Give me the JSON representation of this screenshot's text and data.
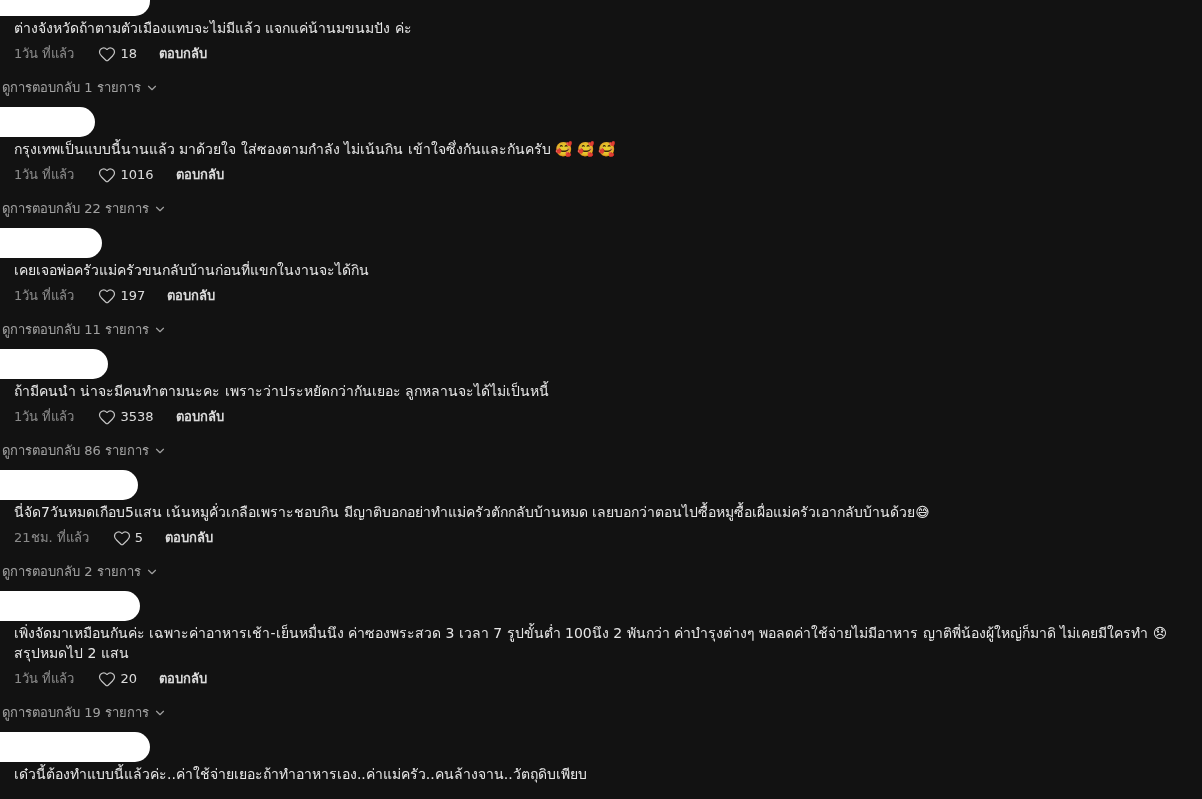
{
  "comments": [
    {
      "author_hidden": true,
      "text": "ต่างจังหวัดถ้าตามตัวเมืองแทบจะไม่มีแล้ว แจกแค่น้านมขนมปัง ค่ะ",
      "time": "1วัน ที่แล้ว",
      "likes": "18",
      "reply_label": "ตอบกลับ",
      "view_replies": "ดูการตอบกลับ 1 รายการ"
    },
    {
      "author_hidden": true,
      "text": "กรุงเทพเป็นแบบนี้นานแล้ว มาด้วยใจ ใส่ซองตามกำลัง ไม่เน้นกิน เข้าใจซึ่งกันและกันครับ 🥰 🥰 🥰",
      "time": "1วัน ที่แล้ว",
      "likes": "1016",
      "reply_label": "ตอบกลับ",
      "view_replies": "ดูการตอบกลับ 22 รายการ"
    },
    {
      "author_hidden": true,
      "text": "เคยเจอพ่อครัวแม่ครัวขนกลับบ้านก่อนที่แขกในงานจะได้กิน",
      "time": "1วัน ที่แล้ว",
      "likes": "197",
      "reply_label": "ตอบกลับ",
      "view_replies": "ดูการตอบกลับ 11 รายการ"
    },
    {
      "author_hidden": true,
      "text": "ถ้ามีคนนำ น่าจะมีคนทำตามนะคะ เพราะว่าประหยัดกว่ากันเยอะ ลูกหลานจะได้ไม่เป็นหนี้",
      "time": "1วัน ที่แล้ว",
      "likes": "3538",
      "reply_label": "ตอบกลับ",
      "view_replies": "ดูการตอบกลับ 86 รายการ"
    },
    {
      "author_hidden": true,
      "text": "นี่จัด7วันหมดเกือบ5แสน เน้นหมูคั่วเกลือเพราะชอบกิน มีญาติบอกอย่าทำแม่ครัวตักกลับบ้านหมด เลยบอกว่าตอนไปซื้อหมูซื้อเผื่อแม่ครัวเอากลับบ้านด้วย😅",
      "time": "21ชม. ที่แล้ว",
      "likes": "5",
      "reply_label": "ตอบกลับ",
      "view_replies": "ดูการตอบกลับ 2 รายการ"
    },
    {
      "author_hidden": true,
      "text": "เพิ่งจัดมาเหมือนกันค่ะ เฉพาะค่าอาหารเช้า-เย็นหมื่นนึง ค่าซองพระสวด 3 เวลา 7 รูปขั้นต่ำ 100นึง 2 พันกว่า ค่าบำรุงต่างๆ พอลดค่าใช้จ่ายไม่มีอาหาร ญาติพี่น้องผู้ใหญ่ก็มาดิ ไม่เคยมีใครทำ 😞 สรุปหมดไป 2 แสน",
      "time": "1วัน ที่แล้ว",
      "likes": "20",
      "reply_label": "ตอบกลับ",
      "view_replies": "ดูการตอบกลับ 19 รายการ"
    },
    {
      "author_hidden": true,
      "text": "เด๋วนี้ต้องทำแบบนี้แล้วค่ะ..ค่าใช้จ่ายเยอะถ้าทำอาหารเอง..ค่าแม่ครัว..คนล้างจาน..วัตถุดิบเพียบ"
    }
  ]
}
